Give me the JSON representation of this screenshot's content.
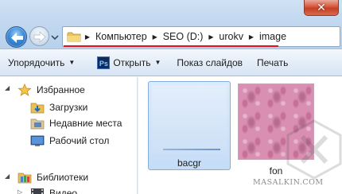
{
  "window": {
    "close_glyph": "✕"
  },
  "address_bar": {
    "crumbs": [
      "Компьютер",
      "SEO (D:)",
      "urokv",
      "image"
    ],
    "separator": "▶",
    "highlight_color": "#e0141e"
  },
  "toolbar": {
    "organize_label": "Упорядочить",
    "open_label": "Открыть",
    "slideshow_label": "Показ слайдов",
    "print_label": "Печать",
    "ps_icon_text": "Ps",
    "caret": "▼"
  },
  "nav_pane": {
    "favorites": {
      "label": "Избранное",
      "icon": "star-icon",
      "expander": "◢"
    },
    "favorite_items": [
      {
        "label": "Загрузки",
        "icon": "downloads-folder-icon"
      },
      {
        "label": "Недавние места",
        "icon": "recent-places-icon"
      },
      {
        "label": "Рабочий стол",
        "icon": "desktop-icon"
      }
    ],
    "libraries": {
      "label": "Библиотеки",
      "icon": "libraries-icon",
      "expander": "◢"
    },
    "library_items": [
      {
        "label": "Видео",
        "icon": "video-library-icon",
        "expander": "▷"
      }
    ]
  },
  "content": {
    "files": [
      {
        "name": "bacgr",
        "selected": true
      },
      {
        "name": "fon",
        "selected": false
      }
    ]
  },
  "watermark": {
    "text": "MASALKIN.COM"
  }
}
